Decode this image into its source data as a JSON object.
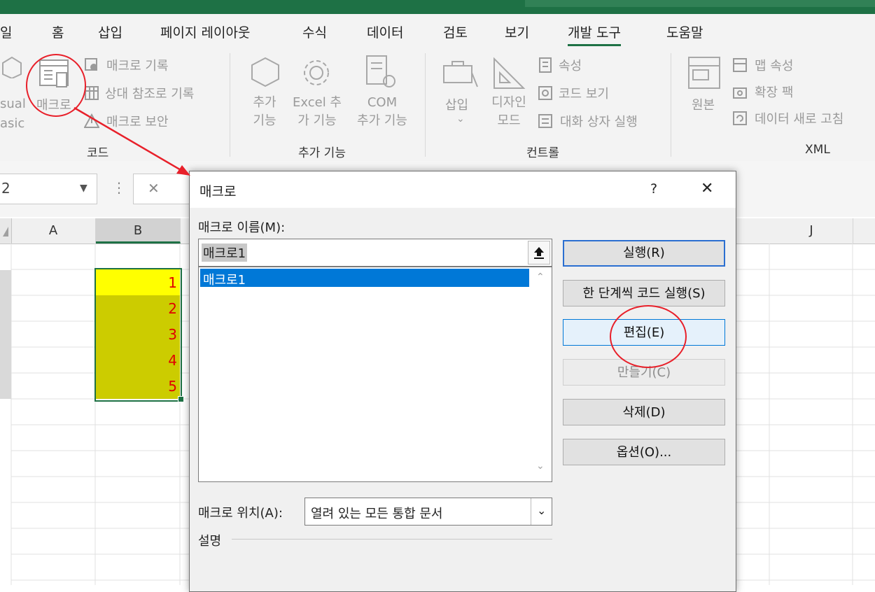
{
  "ribbon": {
    "tabs": [
      "일",
      "홈",
      "삽입",
      "페이지 레이아웃",
      "수식",
      "데이터",
      "검토",
      "보기",
      "개발 도구",
      "도움말"
    ],
    "active_tab": "개발 도구",
    "code_group": {
      "vb_label_1": "sual",
      "vb_label_2": "asic",
      "macro_label": "매크로",
      "record_macro": "매크로 기록",
      "relative_ref": "상대 참조로 기록",
      "macro_security": "매크로 보안",
      "group_label": "코드"
    },
    "addins_group": {
      "addins_1": "추가",
      "addins_2": "기능",
      "excel_addins_1": "Excel 추",
      "excel_addins_2": "가 기능",
      "com_addins_1": "COM",
      "com_addins_2": "추가 기능",
      "group_label": "추가 기능"
    },
    "controls_group": {
      "insert": "삽입",
      "design_mode_1": "디자인",
      "design_mode_2": "모드",
      "properties": "속성",
      "view_code": "코드 보기",
      "run_dialog": "대화 상자 실행",
      "group_label": "컨트롤"
    },
    "xml_group": {
      "source": "원본",
      "map_properties": "맵 속성",
      "expansion_packs": "확장 팩",
      "refresh_data": "데이터 새로 고침",
      "group_label": "XML"
    }
  },
  "formula_bar": {
    "name_box": "2",
    "cancel_symbol": "✕"
  },
  "sheet": {
    "columns": [
      "A",
      "B",
      "J"
    ],
    "cells_b": [
      "1",
      "2",
      "3",
      "4",
      "5"
    ]
  },
  "dialog": {
    "title": "매크로",
    "help": "?",
    "close": "✕",
    "macro_name_label": "매크로 이름(M):",
    "macro_name_value": "매크로1",
    "macro_list": [
      "매크로1"
    ],
    "buttons": {
      "run": "실행(R)",
      "step_into": "한 단계씩 코드 실행(S)",
      "edit": "편집(E)",
      "create": "만들기(C)",
      "delete": "삭제(D)",
      "options": "옵션(O)..."
    },
    "macros_in_label": "매크로 위치(A):",
    "macros_in_value": "열려 있는 모든 통합 문서",
    "description_label": "설명"
  },
  "colors": {
    "excel_green": "#1e7145",
    "highlight_yellow": "#ffff00",
    "fill_olive": "#cccc00",
    "cell_text_red": "#e00000",
    "annotation_red": "#e8202a",
    "selection_blue": "#0078d7"
  }
}
